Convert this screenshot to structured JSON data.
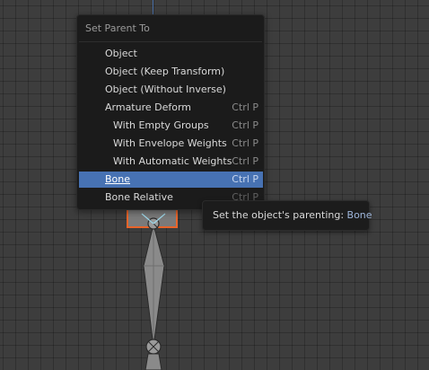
{
  "menu": {
    "title": "Set Parent To",
    "items": [
      {
        "label": "Object",
        "shortcut": ""
      },
      {
        "label": "Object (Keep Transform)",
        "shortcut": ""
      },
      {
        "label": "Object (Without Inverse)",
        "shortcut": ""
      },
      {
        "label": "Armature Deform",
        "shortcut": "Ctrl P"
      },
      {
        "label": "With Empty Groups",
        "shortcut": "Ctrl P"
      },
      {
        "label": "With Envelope Weights",
        "shortcut": "Ctrl P"
      },
      {
        "label": "With Automatic Weights",
        "shortcut": "Ctrl P"
      },
      {
        "label": "Bone",
        "shortcut": "Ctrl P"
      },
      {
        "label": "Bone Relative",
        "shortcut": "Ctrl P"
      }
    ],
    "active_item": "Bone"
  },
  "tooltip": {
    "text": "Set the object's parenting:",
    "value": "Bone"
  },
  "colors": {
    "viewport_bg": "#3d3d3d",
    "menu_bg": "#1b1b1b",
    "highlight": "#4772b3",
    "selected_object_outline": "#e8642a"
  }
}
